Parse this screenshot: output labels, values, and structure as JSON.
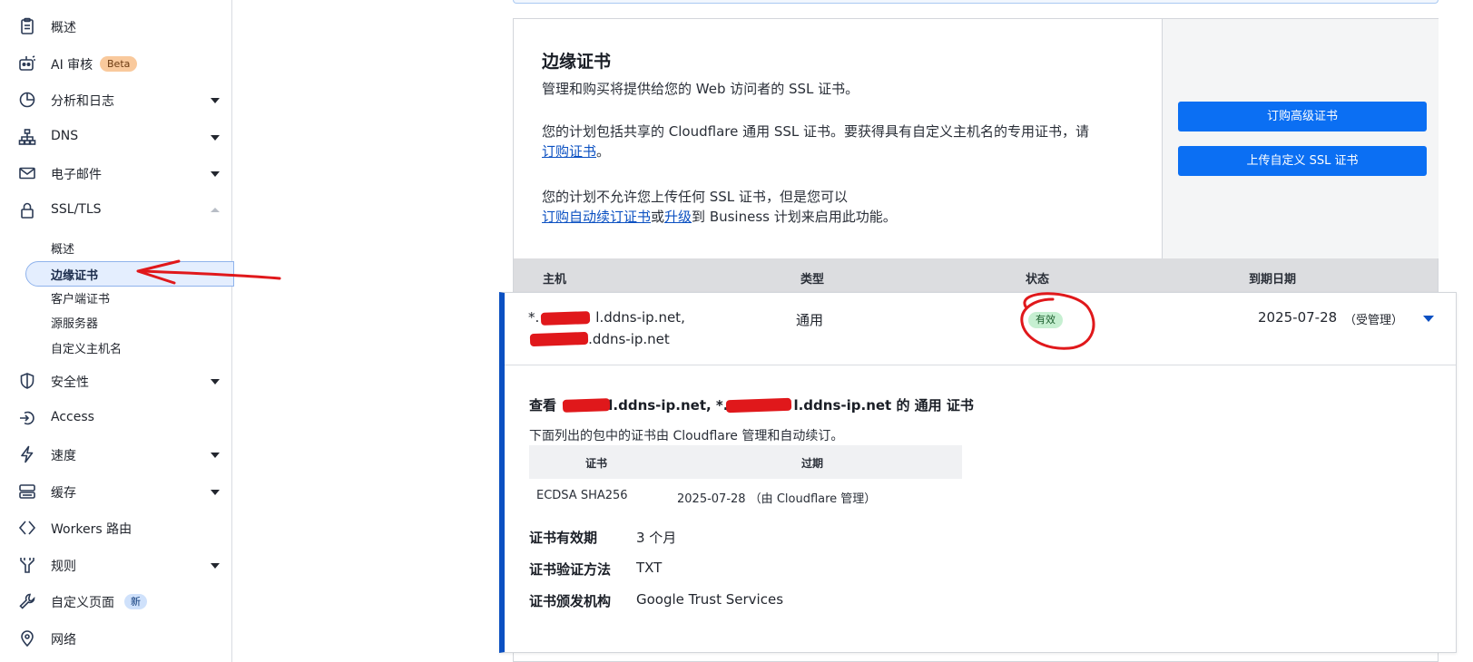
{
  "sidebar": {
    "items": [
      {
        "label": "概述",
        "icon": "clipboard-icon"
      },
      {
        "label": "AI 审核",
        "icon": "robot-icon",
        "badge": "Beta"
      },
      {
        "label": "分析和日志",
        "icon": "pie-chart-icon"
      },
      {
        "label": "DNS",
        "icon": "network-icon"
      },
      {
        "label": "电子邮件",
        "icon": "mail-icon"
      },
      {
        "label": "SSL/TLS",
        "icon": "lock-icon"
      },
      {
        "label": "安全性",
        "icon": "shield-icon"
      },
      {
        "label": "Access",
        "icon": "access-icon"
      },
      {
        "label": "速度",
        "icon": "lightning-icon"
      },
      {
        "label": "缓存",
        "icon": "storage-icon"
      },
      {
        "label": "Workers 路由",
        "icon": "code-icon"
      },
      {
        "label": "规则",
        "icon": "funnel-icon"
      },
      {
        "label": "自定义页面",
        "icon": "wrench-icon",
        "badge": "新"
      },
      {
        "label": "网络",
        "icon": "location-pin-icon"
      }
    ],
    "ssl_sub": [
      "概述",
      "边缘证书",
      "客户端证书",
      "源服务器",
      "自定义主机名"
    ]
  },
  "card": {
    "title": "边缘证书",
    "desc": "管理和购买将提供给您的 Web 访问者的 SSL 证书。",
    "plan_text_1": "您的计划包括共享的 Cloudflare 通用 SSL 证书。要获得具有自定义主机名的专用证书，请",
    "plan_link_1": "订购证书",
    "plan_end_1": "。",
    "plan_text_2": "您的计划不允许您上传任何 SSL 证书，但是您可以",
    "plan_link_2a": "订购自动续订证书",
    "plan_or": "或",
    "plan_link_2b": "升级",
    "plan_text_2_end": "到 Business 计划来启用此功能。",
    "btn_order": "订购高级证书",
    "btn_upload": "上传自定义 SSL 证书"
  },
  "table": {
    "headers": [
      "主机",
      "类型",
      "状态",
      "到期日期"
    ],
    "row": {
      "host_line1_prefix": "*.",
      "host_line1_suffix": "l.ddns-ip.net,",
      "host_line2_suffix": "l.ddns-ip.net",
      "type": "通用",
      "status": "有效",
      "expiry": "2025-07-28",
      "managed": "（受管理）"
    }
  },
  "detail": {
    "title_prefix": "查看",
    "title_host1": "l.ddns-ip.net, *.",
    "title_host2": "l.ddns-ip.net 的 通用 证书",
    "subtitle": "下面列出的包中的证书由 Cloudflare 管理和自动续订。",
    "inner_headers": [
      "证书",
      "过期"
    ],
    "inner_row": {
      "cert": "ECDSA SHA256",
      "expiry": "2025-07-28 （由 Cloudflare 管理）"
    },
    "fields": [
      {
        "key": "证书有效期",
        "value": "3 个月"
      },
      {
        "key": "证书验证方法",
        "value": "TXT"
      },
      {
        "key": "证书颁发机构",
        "value": "Google Trust Services"
      }
    ]
  },
  "colors": {
    "accent": "#0b6ff3",
    "link": "#0b50c2",
    "annotation": "#e0181b",
    "valid": "#c6efd1"
  }
}
